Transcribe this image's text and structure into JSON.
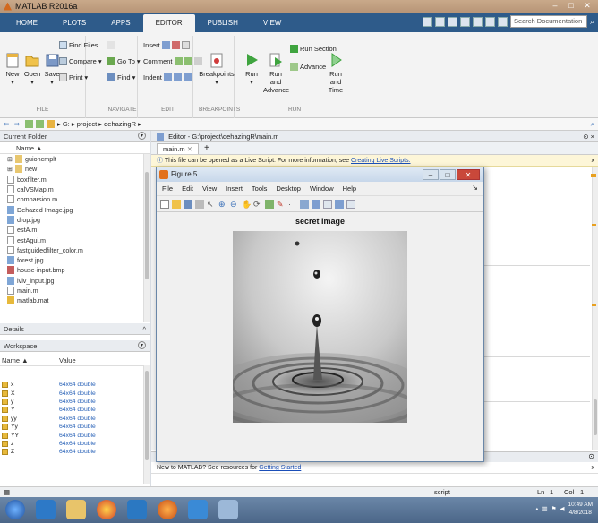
{
  "window": {
    "title": "MATLAB R2016a",
    "controls": [
      "–",
      "□",
      "✕"
    ]
  },
  "ribbon_tabs": [
    "HOME",
    "PLOTS",
    "APPS",
    "EDITOR",
    "PUBLISH",
    "VIEW"
  ],
  "active_tab": "EDITOR",
  "search": {
    "placeholder": "Search Documentation"
  },
  "ribbon": {
    "file": {
      "new": "New",
      "open": "Open",
      "save": "Save",
      "find_files": "Find Files",
      "compare": "Compare",
      "print": "Print",
      "title": "FILE"
    },
    "navigate": {
      "go_to": "Go To",
      "find": "Find",
      "title": "NAVIGATE"
    },
    "edit": {
      "insert": "Insert",
      "comment": "Comment",
      "indent": "Indent",
      "title": "EDIT"
    },
    "breakpoints": {
      "label": "Breakpoints",
      "title": "BREAKPOINTS"
    },
    "run": {
      "run": "Run",
      "run_advance": "Run and Advance",
      "run_section": "Run Section",
      "advance": "Advance",
      "run_time": "Run and Time",
      "title": "RUN"
    }
  },
  "address": {
    "path": "▸ G: ▸ project ▸ dehazingR ▸"
  },
  "current_folder": {
    "title": "Current Folder",
    "column": "Name ▲",
    "files": [
      "guioncmplt",
      "new",
      "boxfilter.m",
      "calVSMap.m",
      "comparsion.m",
      "Dehazed Image.jpg",
      "drop.jpg",
      "estA.m",
      "estAgui.m",
      "fastguidedfilter_color.m",
      "forest.jpg",
      "house-input.bmp",
      "lviv_input.jpg",
      "main.m",
      "matlab.mat"
    ]
  },
  "details": {
    "title": "Details"
  },
  "workspace": {
    "title": "Workspace",
    "col_name": "Name ▲",
    "col_value": "Value",
    "rows": [
      {
        "name": "x",
        "value": "64x64 double"
      },
      {
        "name": "X",
        "value": "64x64 double"
      },
      {
        "name": "y",
        "value": "64x64 double"
      },
      {
        "name": "Y",
        "value": "64x64 double"
      },
      {
        "name": "yy",
        "value": "64x64 double"
      },
      {
        "name": "Yy",
        "value": "64x64 double"
      },
      {
        "name": "YY",
        "value": "64x64 double"
      },
      {
        "name": "z",
        "value": "64x64 double"
      },
      {
        "name": "Z",
        "value": "64x64 double"
      }
    ]
  },
  "editor": {
    "title": "Editor - G:\\project\\dehazingR\\main.m",
    "tab": "main.m",
    "tab_close": "✕",
    "plus": "+",
    "info_text": "This file can be opened as a Live Script. For more information, see ",
    "info_link": "Creating Live Scripts.",
    "info_close": "x"
  },
  "command_window": {
    "text": "New to MATLAB? See resources for ",
    "link": "Getting Started",
    "close": "x"
  },
  "status": {
    "mode": "script",
    "ln_label": "Ln",
    "ln": "1",
    "col_label": "Col",
    "col": "1"
  },
  "figure": {
    "title": "Figure 5",
    "menu": [
      "File",
      "Edit",
      "View",
      "Insert",
      "Tools",
      "Desktop",
      "Window",
      "Help"
    ],
    "heading": "secret image"
  },
  "clock": {
    "time": "10:49 AM",
    "date": "4/8/2018"
  },
  "colors": {
    "accent": "#2e5b8a",
    "taskbar": "#4b6688",
    "link": "#1a4fb8"
  }
}
